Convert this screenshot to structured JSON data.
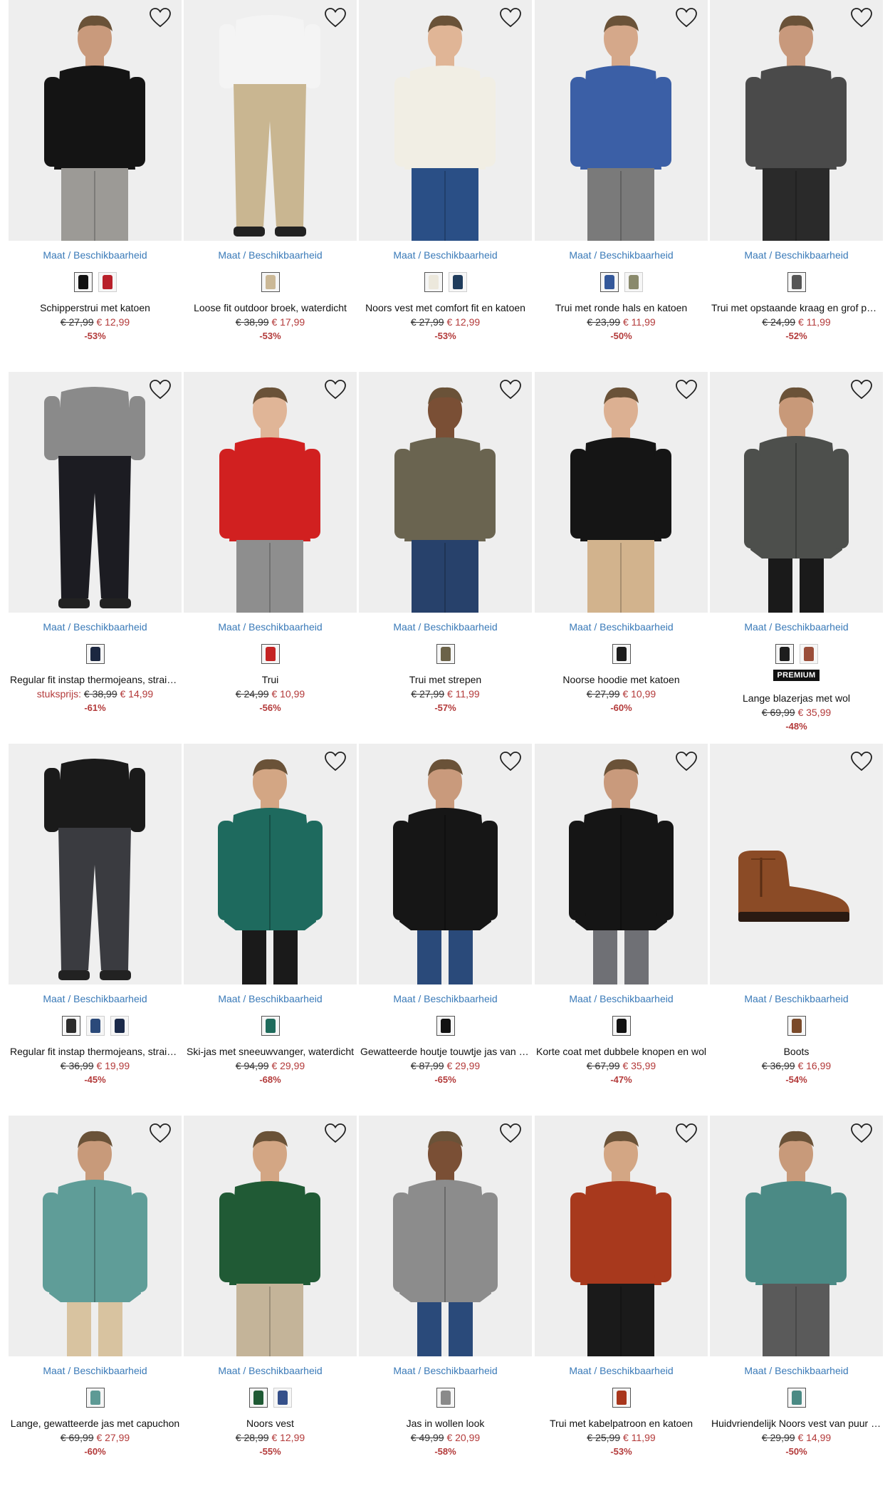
{
  "size_label": "Maat / Beschikbaarheid",
  "products": [
    {
      "name": "Schipperstrui met katoen",
      "old_price": "€ 27,99",
      "new_price": "€ 12,99",
      "discount": "-53%",
      "swatches": [
        "#111111",
        "#b8202a"
      ],
      "bg": "#eeeeee",
      "top": "#141414",
      "bottom": "#9c9a96",
      "skin": "#c99a7c",
      "type": "sweater",
      "icon": "heart-icon"
    },
    {
      "name": "Loose fit outdoor broek, waterdicht",
      "old_price": "€ 38,99",
      "new_price": "€ 17,99",
      "discount": "-53%",
      "swatches": [
        "#cbb896"
      ],
      "bg": "#efefef",
      "top": "#f4f4f4",
      "bottom": "#c9b691",
      "skin": "#d3a98c",
      "type": "pants",
      "icon": "heart-icon"
    },
    {
      "name": "Noors vest met comfort fit en katoen",
      "old_price": "€ 27,99",
      "new_price": "€ 12,99",
      "discount": "-53%",
      "swatches": [
        "#ece8dc",
        "#1f3c5c"
      ],
      "bg": "#eeeeee",
      "top": "#f1eee4",
      "bottom": "#2a4f86",
      "skin": "#e0b596",
      "type": "sweater",
      "icon": "heart-icon"
    },
    {
      "name": "Trui met ronde hals en katoen",
      "old_price": "€ 23,99",
      "new_price": "€ 11,99",
      "discount": "-50%",
      "swatches": [
        "#34589a",
        "#8a8a6c"
      ],
      "bg": "#eeeeee",
      "top": "#3b5fa6",
      "bottom": "#7a7a7a",
      "skin": "#d5a88a",
      "type": "sweater",
      "icon": "heart-icon"
    },
    {
      "name": "Trui met opstaande kraag en grof patroon",
      "old_price": "€ 24,99",
      "new_price": "€ 11,99",
      "discount": "-52%",
      "swatches": [
        "#555555"
      ],
      "bg": "#eeeeee",
      "top": "#4a4a4a",
      "bottom": "#2a2a2a",
      "skin": "#c8997c",
      "type": "sweater",
      "icon": "heart-icon"
    },
    {
      "name": "Regular fit instap thermojeans, straight",
      "prefix": "stuksprijs:",
      "old_price": "€ 38,99",
      "new_price": "€ 14,99",
      "discount": "-61%",
      "swatches": [
        "#1c2740"
      ],
      "bg": "#efefef",
      "top": "#8a8a8a",
      "bottom": "#1c1c22",
      "skin": "#d0a387",
      "type": "pants",
      "icon": "heart-icon"
    },
    {
      "name": "Trui",
      "old_price": "€ 24,99",
      "new_price": "€ 10,99",
      "discount": "-56%",
      "swatches": [
        "#c52424"
      ],
      "bg": "#eeeeee",
      "top": "#d12020",
      "bottom": "#8e8e8e",
      "skin": "#e0b597",
      "type": "sweater",
      "icon": "heart-icon"
    },
    {
      "name": "Trui met strepen",
      "old_price": "€ 27,99",
      "new_price": "€ 11,99",
      "discount": "-57%",
      "swatches": [
        "#6b6248"
      ],
      "bg": "#eeeeee",
      "top": "#6a6450",
      "bottom": "#27416b",
      "skin": "#7a4f35",
      "type": "sweater",
      "icon": "heart-icon"
    },
    {
      "name": "Noorse hoodie met katoen",
      "old_price": "€ 27,99",
      "new_price": "€ 10,99",
      "discount": "-60%",
      "swatches": [
        "#1b1b1b"
      ],
      "bg": "#eeeeee",
      "top": "#151515",
      "bottom": "#d2b38d",
      "skin": "#dcb092",
      "type": "sweater",
      "icon": "heart-icon"
    },
    {
      "name": "Lange blazerjas met wol",
      "badge": "PREMIUM",
      "old_price": "€ 69,99",
      "new_price": "€ 35,99",
      "discount": "-48%",
      "swatches": [
        "#1d1d1d",
        "#9a4e3a"
      ],
      "bg": "#eeeeee",
      "top": "#4d4f4c",
      "bottom": "#1a1a1a",
      "skin": "#c89979",
      "type": "coat",
      "icon": "heart-icon"
    },
    {
      "name": "Regular fit instap thermojeans, straight",
      "old_price": "€ 36,99",
      "new_price": "€ 19,99",
      "discount": "-45%",
      "swatches": [
        "#2c2c2c",
        "#2b4a7a",
        "#1b2a4a"
      ],
      "bg": "#efefef",
      "top": "#1a1a1a",
      "bottom": "#3a3b40",
      "skin": "#d0a387",
      "type": "pants",
      "icon": ""
    },
    {
      "name": "Ski-jas met sneeuwvanger, waterdicht",
      "old_price": "€ 94,99",
      "new_price": "€ 29,99",
      "discount": "-68%",
      "swatches": [
        "#1f6b5c"
      ],
      "bg": "#eeeeee",
      "top": "#1e6a5e",
      "bottom": "#1a1a1a",
      "skin": "#d3a684",
      "type": "coat",
      "icon": "heart-icon"
    },
    {
      "name": "Gewatteerde houtje touwtje jas van wol",
      "old_price": "€ 87,99",
      "new_price": "€ 29,99",
      "discount": "-65%",
      "swatches": [
        "#111111"
      ],
      "bg": "#eeeeee",
      "top": "#161616",
      "bottom": "#2a4a7a",
      "skin": "#c99a7c",
      "type": "coat",
      "icon": "heart-icon"
    },
    {
      "name": "Korte coat met dubbele knopen en wol",
      "old_price": "€ 67,99",
      "new_price": "€ 35,99",
      "discount": "-47%",
      "swatches": [
        "#111111"
      ],
      "bg": "#eeeeee",
      "top": "#151515",
      "bottom": "#6f7075",
      "skin": "#c99a7c",
      "type": "coat",
      "icon": "heart-icon"
    },
    {
      "name": "Boots",
      "old_price": "€ 36,99",
      "new_price": "€ 16,99",
      "discount": "-54%",
      "swatches": [
        "#7a4a2a"
      ],
      "bg": "#efefef",
      "top": "#8b4b26",
      "bottom": "#2a1a12",
      "skin": "#000000",
      "type": "boot",
      "icon": "heart-icon"
    },
    {
      "name": "Lange, gewatteerde jas met capuchon",
      "old_price": "€ 69,99",
      "new_price": "€ 27,99",
      "discount": "-60%",
      "swatches": [
        "#5e9a95"
      ],
      "bg": "#eeeeee",
      "top": "#5f9d98",
      "bottom": "#d8c3a0",
      "skin": "#c89a7a",
      "type": "coat",
      "icon": "heart-icon"
    },
    {
      "name": "Noors vest",
      "old_price": "€ 28,99",
      "new_price": "€ 12,99",
      "discount": "-55%",
      "swatches": [
        "#1f5a34",
        "#35508a"
      ],
      "bg": "#eeeeee",
      "top": "#205a35",
      "bottom": "#c4b499",
      "skin": "#d3a684",
      "type": "sweater",
      "icon": "heart-icon"
    },
    {
      "name": "Jas in wollen look",
      "old_price": "€ 49,99",
      "new_price": "€ 20,99",
      "discount": "-58%",
      "swatches": [
        "#8a8a8a"
      ],
      "bg": "#eeeeee",
      "top": "#8c8c8c",
      "bottom": "#2a4a7a",
      "skin": "#7a4f35",
      "type": "coat",
      "icon": "heart-icon"
    },
    {
      "name": "Trui met kabelpatroon en katoen",
      "old_price": "€ 25,99",
      "new_price": "€ 11,99",
      "discount": "-53%",
      "swatches": [
        "#a8361c"
      ],
      "bg": "#eeeeee",
      "top": "#a8391d",
      "bottom": "#1a1a1a",
      "skin": "#d3a684",
      "type": "sweater",
      "icon": "heart-icon"
    },
    {
      "name": "Huidvriendelijk Noors vest van puur katoen",
      "old_price": "€ 29,99",
      "new_price": "€ 14,99",
      "discount": "-50%",
      "swatches": [
        "#4a8a84"
      ],
      "bg": "#eeeeee",
      "top": "#4b8a85",
      "bottom": "#5a5a5a",
      "skin": "#c89a7a",
      "type": "sweater",
      "icon": "heart-icon"
    }
  ]
}
